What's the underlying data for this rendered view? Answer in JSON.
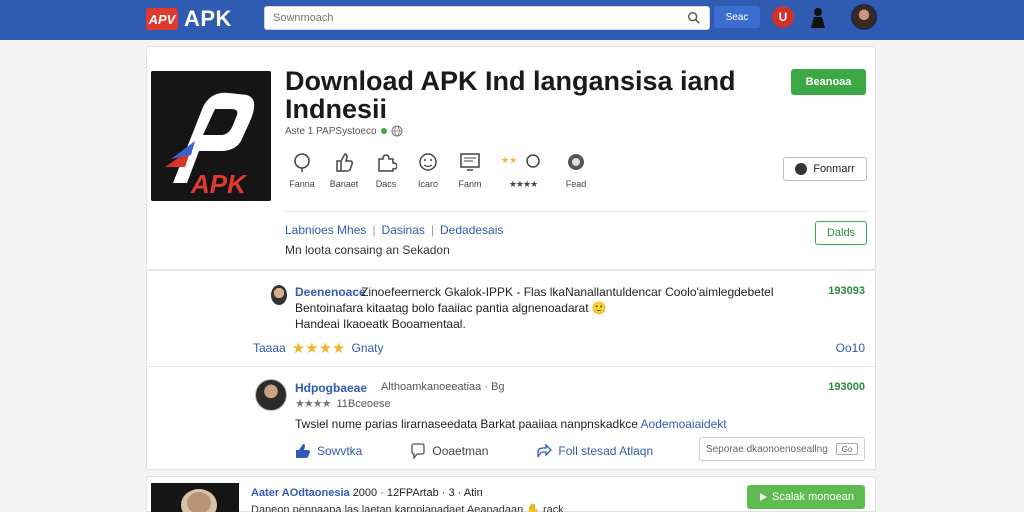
{
  "header": {
    "logo_badge": "APV",
    "logo_text": "APK",
    "search_placeholder": "Sownmoach",
    "search_button": "Seac",
    "bell_label": "U"
  },
  "app": {
    "title": "Download APK Ind langansisa iand Indnesii",
    "meta": "Aste 1 PAPSystoeco",
    "download_label": "Beanoaa",
    "follow_label": "Fonmarr",
    "icon_text": "APK",
    "stats": [
      {
        "icon": "info-icon",
        "label": "Fanna"
      },
      {
        "icon": "thumb-icon",
        "label": "Banaet"
      },
      {
        "icon": "puzzle-icon",
        "label": "Dacs"
      },
      {
        "icon": "smile-icon",
        "label": "Icaro"
      },
      {
        "icon": "screen-icon",
        "label": "Fanm"
      },
      {
        "icon": "rating-icon",
        "label": "★★★★"
      },
      {
        "icon": "camera-icon",
        "label": "Fead"
      }
    ],
    "tags": [
      "Labnioes Mhes",
      "Dasinas",
      "Dedadesais"
    ],
    "description": "Mn loota consaing an Sekadon",
    "details_label": "Dalds"
  },
  "reviews": [
    {
      "name": "Deenenoace",
      "text_line1": "Zinoefeernerck Gkalok-IPPK - Flas lkaNanallantuldencar Coolo'aimlegdebetel",
      "text_line2": "Bentoinafara kitaatag bolo faaiiac pantia algnenoadarat 🙂",
      "text_line3": "Handeai Ikaoeatk Booamentaal.",
      "date": "193093",
      "rate_label": "Taaaa",
      "rating": "★★★★",
      "rate_link": "Gnaty",
      "rate_right": "Oo10"
    },
    {
      "name": "Hdpogbaeae",
      "meta": "Althoamkanoeeatiaa · Bg",
      "stars": "★★★★",
      "sub": "11Bceoese",
      "text": "Twsiel nume parias lirarnaseedata Barkat paaiiaa nanpnskadkce",
      "text_link": "Aodemoaiaidekt",
      "date": "193000",
      "like_label": "Sowvtka",
      "comment_label": "Ooaetman",
      "share_label": "Foll stesad Atlaqn",
      "reply_placeholder": "Seporae dkaonoenoseallng",
      "reply_send": "Go"
    }
  ],
  "next_app": {
    "title_bold": "Aater AOdtaonesia",
    "title_rest": "2000 · 12FPArtab · 3 · Atin",
    "sub": "Daneon pennaapa las laetan karnpianadaet Aeanadaan ✋ rack",
    "button": "Scalak monoean"
  },
  "colors": {
    "topbar": "#2f5bb2",
    "accent_green": "#39a845",
    "link_blue": "#2f5bb2",
    "brand_red": "#e03a2f",
    "star": "#f1b52c"
  }
}
